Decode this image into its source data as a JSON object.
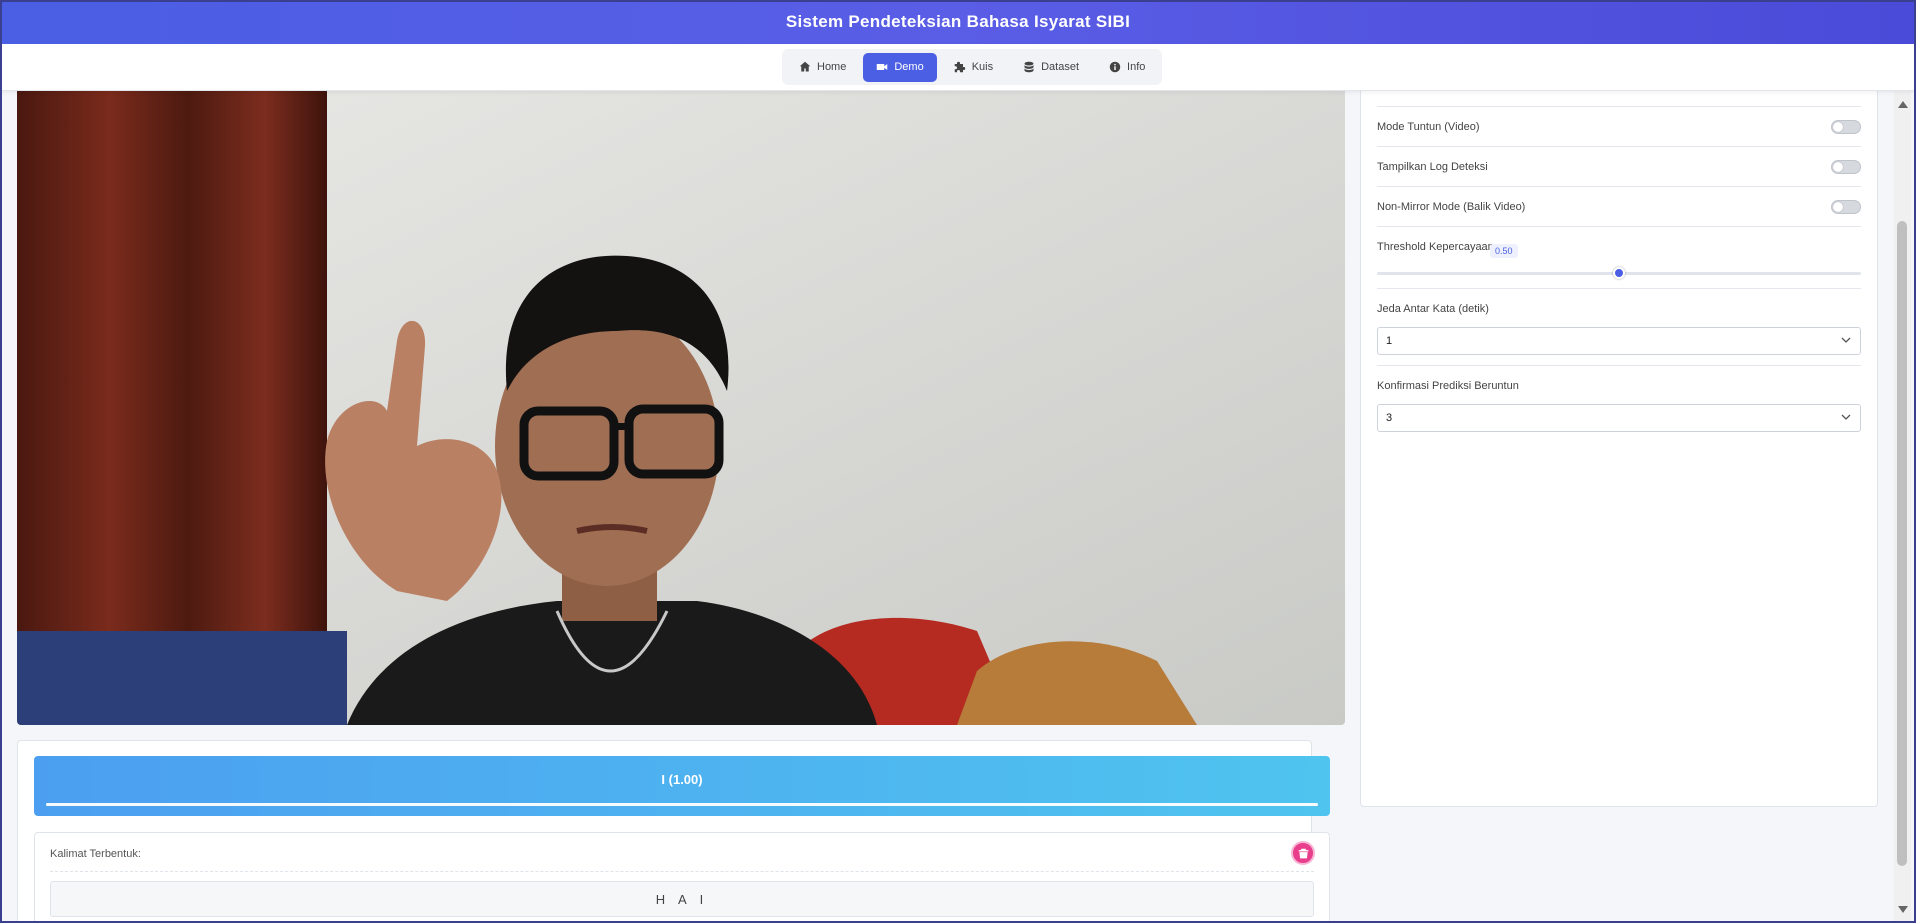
{
  "app": {
    "title": "Sistem Pendeteksian Bahasa Isyarat SIBI"
  },
  "nav": {
    "items": [
      {
        "label": "Home",
        "icon": "home-icon",
        "active": false
      },
      {
        "label": "Demo",
        "icon": "video-camera-icon",
        "active": true
      },
      {
        "label": "Kuis",
        "icon": "puzzle-icon",
        "active": false
      },
      {
        "label": "Dataset",
        "icon": "database-icon",
        "active": false
      },
      {
        "label": "Info",
        "icon": "info-icon",
        "active": false
      }
    ],
    "accent_color": "#4a5fe4"
  },
  "video": {
    "description_icon": "webcam-feed"
  },
  "prediction": {
    "text": "I (1.00)",
    "confidence": 1.0
  },
  "sentence": {
    "label": "Kalimat Terbentuk:",
    "value": "H A I",
    "clear_icon": "trash-icon"
  },
  "settings": {
    "toggles": [
      {
        "label": "Mode Tuntun (Video)",
        "on": false
      },
      {
        "label": "Tampilkan Log Deteksi",
        "on": false
      },
      {
        "label": "Non-Mirror Mode (Balik Video)",
        "on": false
      }
    ],
    "threshold": {
      "label": "Threshold Kepercayaan:",
      "value": "0.50",
      "fraction": 0.5
    },
    "word_delay": {
      "label": "Jeda Antar Kata (detik)",
      "selected": "1"
    },
    "confirmation": {
      "label": "Konfirmasi Prediksi Beruntun",
      "selected": "3"
    }
  }
}
